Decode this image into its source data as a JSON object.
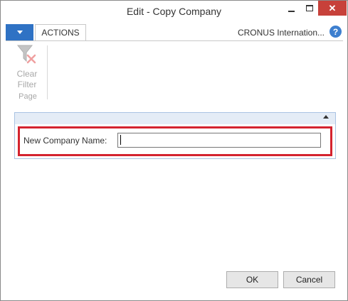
{
  "window": {
    "title": "Edit - Copy Company",
    "close_glyph": "✕"
  },
  "ribbon": {
    "tabs": [
      {
        "label": "ACTIONS",
        "selected": true
      }
    ],
    "company": "CRONUS Internation...",
    "help_glyph": "?",
    "groups": [
      {
        "label": "Page",
        "actions": [
          {
            "label_line1": "Clear",
            "label_line2": "Filter",
            "icon": "clear-filter-icon",
            "enabled": false
          }
        ]
      }
    ]
  },
  "form": {
    "fields": [
      {
        "label": "New Company Name:",
        "value": ""
      }
    ]
  },
  "footer": {
    "ok_label": "OK",
    "cancel_label": "Cancel"
  },
  "colors": {
    "accent": "#2f72c4",
    "close": "#c7413a",
    "highlight": "#d4232f",
    "fasttab_border": "#a9c3e3"
  }
}
